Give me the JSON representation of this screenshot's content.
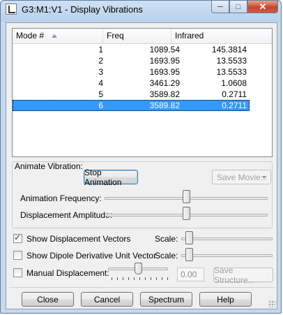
{
  "window": {
    "title": "G3:M1:V1 - Display Vibrations"
  },
  "table": {
    "headers": [
      "Mode #",
      "Freq",
      "Infrared"
    ],
    "rows": [
      {
        "mode": "1",
        "freq": "1089.54",
        "ir": "145.3814"
      },
      {
        "mode": "2",
        "freq": "1693.95",
        "ir": "13.5533"
      },
      {
        "mode": "3",
        "freq": "1693.95",
        "ir": "13.5533"
      },
      {
        "mode": "4",
        "freq": "3461.29",
        "ir": "1.0608"
      },
      {
        "mode": "5",
        "freq": "3589.82",
        "ir": "0.2711"
      },
      {
        "mode": "6",
        "freq": "3589.82",
        "ir": "0.2711"
      }
    ],
    "selected_index": 5
  },
  "animate": {
    "group_label": "Animate Vibration:",
    "stop_button": "Stop Animation",
    "save_movie": "Save Movie...",
    "freq_label": "Animation Frequency:",
    "freq_value": 0.5,
    "amp_label": "Displacement Amplitude:",
    "amp_value": 0.5
  },
  "options": {
    "show_disp_vectors": "Show Displacement Vectors",
    "show_disp_checked": true,
    "scale_label": "Scale:",
    "scale1_value": 0.05,
    "show_dipole": "Show Dipole Derivative Unit Vector",
    "show_dipole_checked": false,
    "scale2_value": 0.05,
    "manual_disp": "Manual Displacement:",
    "manual_checked": false,
    "manual_value_text": "0.00",
    "manual_slider_value": 0.5,
    "save_structure": "Save Structure..."
  },
  "buttons": {
    "close": "Close",
    "cancel": "Cancel",
    "spectrum": "Spectrum",
    "help": "Help"
  },
  "icons": {
    "app": "gaussview-icon",
    "minimize": "minimize-icon",
    "maximize": "maximize-icon",
    "close": "close-icon"
  }
}
